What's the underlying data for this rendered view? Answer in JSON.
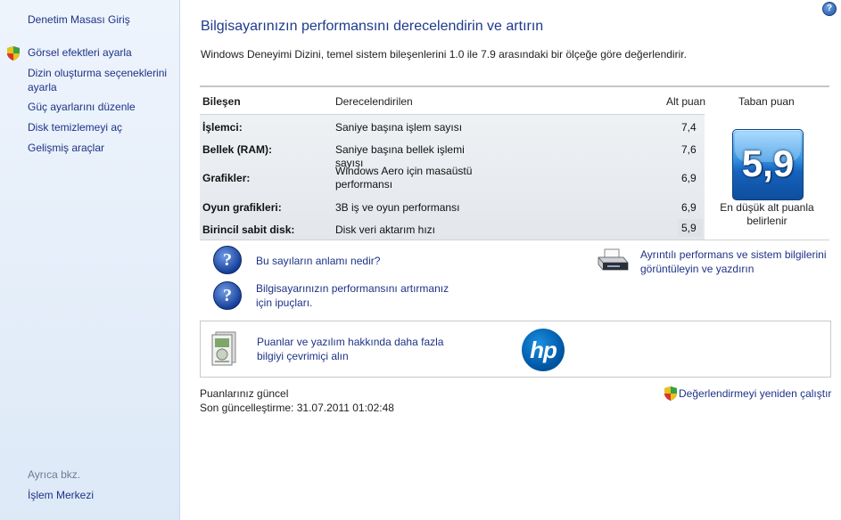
{
  "sidebar": {
    "home": "Denetim Masası Giriş",
    "links": [
      "Görsel efektleri ayarla",
      "Dizin oluşturma seçeneklerini ayarla",
      "Güç ayarlarını düzenle",
      "Disk temizlemeyi aç",
      "Gelişmiş araçlar"
    ],
    "see_also_label": "Ayrıca bkz.",
    "see_also_link": "İşlem Merkezi"
  },
  "main": {
    "title": "Bilgisayarınızın performansını derecelendirin ve artırın",
    "description": "Windows Deneyimi Dizini, temel sistem bileşenlerini 1.0 ile 7.9 arasındaki bir ölçeğe göre değerlendirir.",
    "help_icon_label": "?"
  },
  "table": {
    "headers": {
      "component": "Bileşen",
      "rated": "Derecelendirilen",
      "subscore": "Alt puan",
      "base": "Taban puan"
    },
    "rows": [
      {
        "component": "İşlemci:",
        "rated": "Saniye başına işlem sayısı",
        "subscore": "7,4"
      },
      {
        "component": "Bellek (RAM):",
        "rated": "Saniye başına bellek işlemi sayısı",
        "subscore": "7,6"
      },
      {
        "component": "Grafikler:",
        "rated": "Windows Aero için masaüstü performansı",
        "subscore": "6,9"
      },
      {
        "component": "Oyun grafikleri:",
        "rated": "3B iş ve oyun performansı",
        "subscore": "6,9"
      },
      {
        "component": "Birincil sabit disk:",
        "rated": "Disk veri aktarım hızı",
        "subscore": "5,9"
      }
    ],
    "base_score": "5,9",
    "base_caption": "En düşük alt puanla belirlenir"
  },
  "links": {
    "meaning": "Bu sayıların anlamı nedir?",
    "tips": "Bilgisayarınızın performansını artırmanız için ipuçları.",
    "print_details": "Ayrıntılı performans ve sistem bilgilerini görüntüleyin ve yazdırın",
    "online_info": "Puanlar ve yazılım hakkında daha fazla bilgiyi çevrimiçi alın",
    "question_glyph": "?"
  },
  "brand": {
    "logo_text": "hp"
  },
  "status": {
    "current": "Puanlarınız güncel",
    "last_updated": "Son güncelleştirme: 31.07.2011 01:02:48",
    "rerun": "Değerlendirmeyi yeniden çalıştır"
  },
  "colors": {
    "link": "#1e3287",
    "title": "#1e3a8c",
    "sidebar_bg": "#eef4fc",
    "tile_blue": "#1562bd"
  }
}
